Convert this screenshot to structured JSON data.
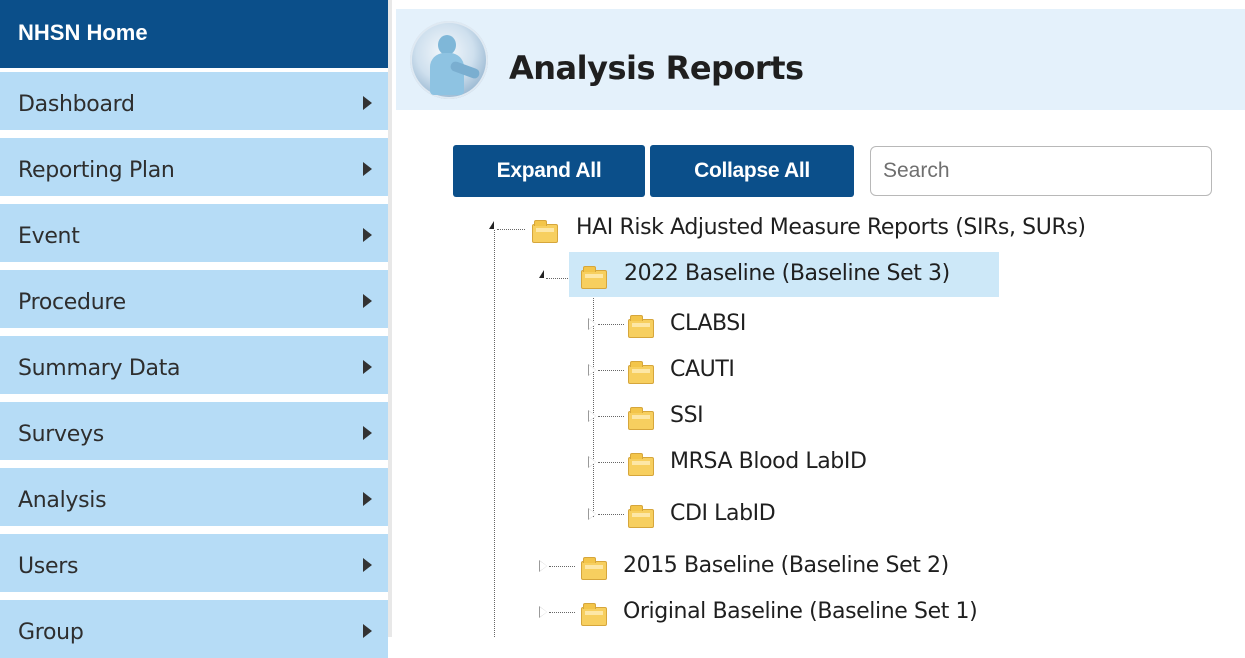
{
  "sidebar": {
    "header": "NHSN Home",
    "items": [
      {
        "label": "Dashboard"
      },
      {
        "label": "Reporting Plan"
      },
      {
        "label": "Event"
      },
      {
        "label": "Procedure"
      },
      {
        "label": "Summary Data"
      },
      {
        "label": "Surveys"
      },
      {
        "label": "Analysis"
      },
      {
        "label": "Users"
      },
      {
        "label": "Group"
      }
    ]
  },
  "header": {
    "title": "Analysis Reports"
  },
  "toolbar": {
    "expand_label": "Expand All",
    "collapse_label": "Collapse All",
    "search_placeholder": "Search"
  },
  "tree": {
    "root": {
      "label": "HAI Risk Adjusted Measure Reports (SIRs, SURs)",
      "expanded": true
    },
    "children": [
      {
        "label": "2022 Baseline (Baseline Set 3)",
        "expanded": true,
        "selected": true,
        "children": [
          {
            "label": "CLABSI"
          },
          {
            "label": "CAUTI"
          },
          {
            "label": "SSI"
          },
          {
            "label": "MRSA Blood LabID"
          },
          {
            "label": "CDI LabID"
          }
        ]
      },
      {
        "label": "2015 Baseline (Baseline Set 2)",
        "expanded": false
      },
      {
        "label": "Original Baseline (Baseline Set 1)",
        "expanded": false
      }
    ]
  },
  "colors": {
    "brand_navy": "#0b4f8a",
    "sidebar_item_bg": "#b6dcf6",
    "header_bg": "#e4f1fb",
    "selected_node_bg": "#cde8f8",
    "folder": "#f7cf5f"
  }
}
